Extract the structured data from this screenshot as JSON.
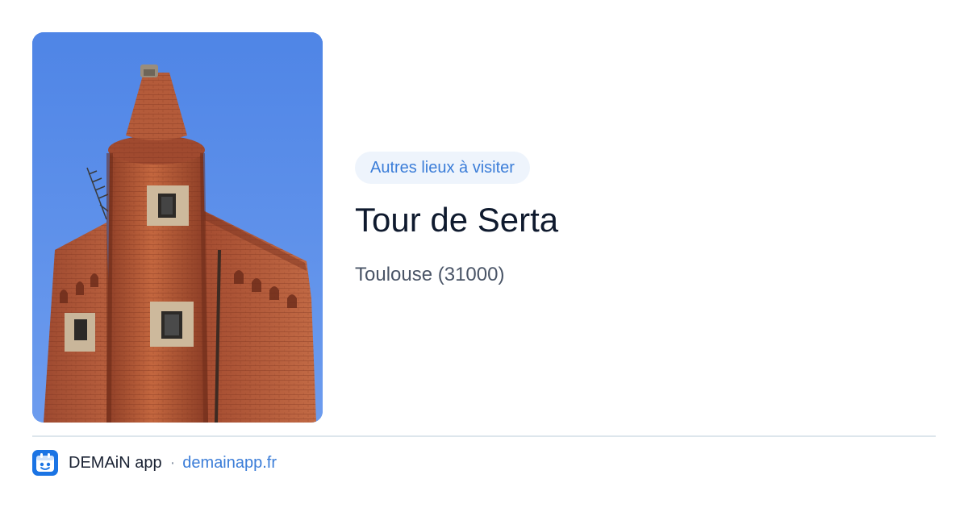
{
  "badge": {
    "label": "Autres lieux à visiter"
  },
  "place": {
    "title": "Tour de Serta",
    "location": "Toulouse (31000)"
  },
  "photo": {
    "subject": "brick-tower-photo"
  },
  "footer": {
    "app_name": "DEMAiN app",
    "separator": "·",
    "url": "demainapp.fr",
    "icon": "demain-app-icon"
  },
  "colors": {
    "accent": "#3b7dd8",
    "badge_bg": "#eef4fc",
    "title": "#0f1a2e",
    "sky": "#5b8fe8",
    "brick": "#b5583a"
  }
}
